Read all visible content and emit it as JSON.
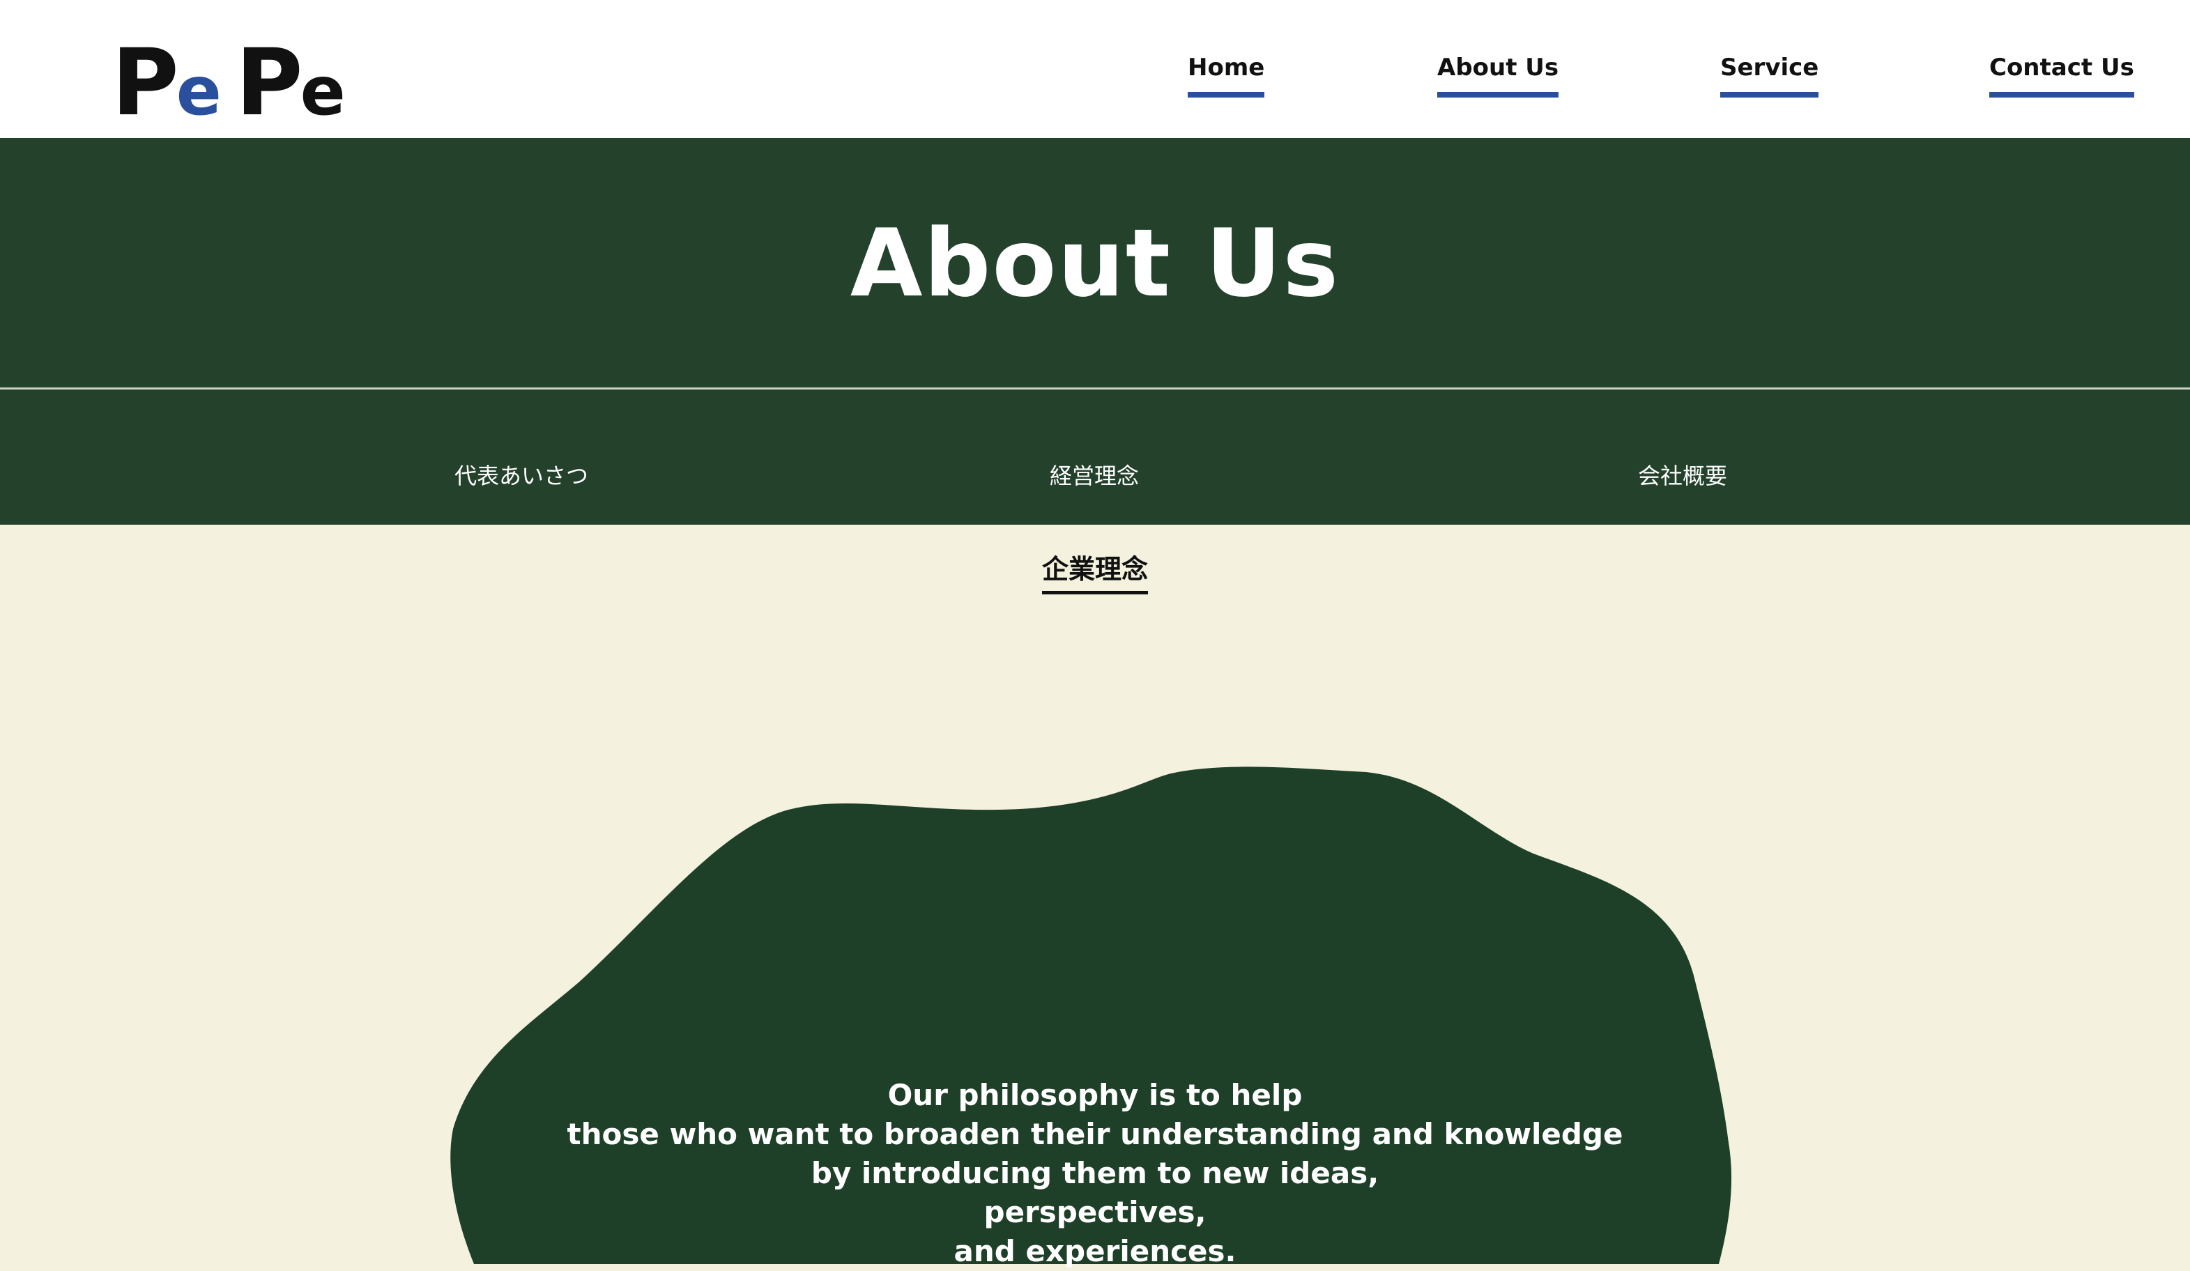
{
  "header": {
    "logo": {
      "letters": [
        "P",
        "e",
        "P",
        "e"
      ]
    },
    "nav": [
      {
        "label": "Home"
      },
      {
        "label": "About Us"
      },
      {
        "label": "Service"
      },
      {
        "label": "Contact Us"
      }
    ]
  },
  "hero": {
    "title": "About Us"
  },
  "subnav": [
    {
      "label": "代表あいさつ"
    },
    {
      "label": "経営理念"
    },
    {
      "label": "会社概要"
    }
  ],
  "section": {
    "title": "企業理念",
    "philosophy_lines": [
      "Our philosophy is to help",
      "those who want to broaden their understanding and knowledge",
      "by introducing them to new ideas,",
      "perspectives,",
      "and experiences."
    ]
  },
  "colors": {
    "header_bg": "#ffffff",
    "hero_bg": "#24412c",
    "page_bg": "#f4f2df",
    "blob": "#1e3f28",
    "nav_underline": "#2a4f9c",
    "logo_accent": "#2a4f9c"
  }
}
